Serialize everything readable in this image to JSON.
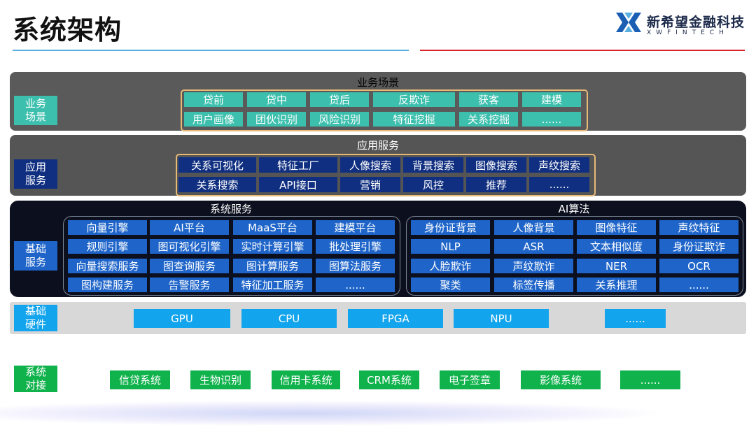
{
  "header": {
    "title": "系统架构",
    "logo_cn": "新希望金融科技",
    "logo_en": "XWFINTECH"
  },
  "colors": {
    "blue_rule": "#5aaee0",
    "red_rule": "#d9262c",
    "business_band": "#5a5a5a",
    "teal_cell": "#3cbfad",
    "application_band": "#555555",
    "navy_cell": "#102f80",
    "foundation_band": "#0c0f1e",
    "blue_cell": "#1f65c9",
    "hardware_band": "#d8d8d8",
    "sky_cell": "#12a4ec",
    "green_cell": "#10b24c"
  },
  "business": {
    "side_label": "业务\n场景",
    "title": "业务场景",
    "row1": [
      "贷前",
      "贷中",
      "贷后",
      "反欺诈",
      "获客",
      "建模"
    ],
    "row2": [
      "用户画像",
      "团伙识别",
      "风险识别",
      "特征挖掘",
      "关系挖掘",
      "......"
    ]
  },
  "application": {
    "side_label": "应用\n服务",
    "title": "应用服务",
    "row1": [
      "关系可视化",
      "特征工厂",
      "人像搜索",
      "背景搜索",
      "图像搜索",
      "声纹搜索"
    ],
    "row2": [
      "关系搜索",
      "API接口",
      "营销",
      "风控",
      "推荐",
      "......"
    ]
  },
  "foundation": {
    "side_label": "基础\n服务",
    "system_services": {
      "title": "系统服务",
      "rows": [
        [
          "向量引擎",
          "AI平台",
          "MaaS平台",
          "建模平台"
        ],
        [
          "规则引擎",
          "图可视化引擎",
          "实时计算引擎",
          "批处理引擎"
        ],
        [
          "向量搜索服务",
          "图查询服务",
          "图计算服务",
          "图算法服务"
        ],
        [
          "图构建服务",
          "告警服务",
          "特征加工服务",
          "......"
        ]
      ]
    },
    "ai_algorithms": {
      "title": "AI算法",
      "rows": [
        [
          "身份证背景",
          "人像背景",
          "图像特征",
          "声纹特征"
        ],
        [
          "NLP",
          "ASR",
          "文本相似度",
          "身份证欺诈"
        ],
        [
          "人脸欺诈",
          "声纹欺诈",
          "NER",
          "OCR"
        ],
        [
          "聚类",
          "标签传播",
          "关系推理",
          "......"
        ]
      ]
    }
  },
  "hardware": {
    "side_label": "基础\n硬件",
    "items": [
      "GPU",
      "CPU",
      "FPGA",
      "NPU",
      "......"
    ]
  },
  "integration": {
    "side_label": "系统\n对接",
    "items": [
      "信贷系统",
      "生物识别",
      "信用卡系统",
      "CRM系统",
      "电子签章",
      "影像系统",
      "......"
    ]
  }
}
